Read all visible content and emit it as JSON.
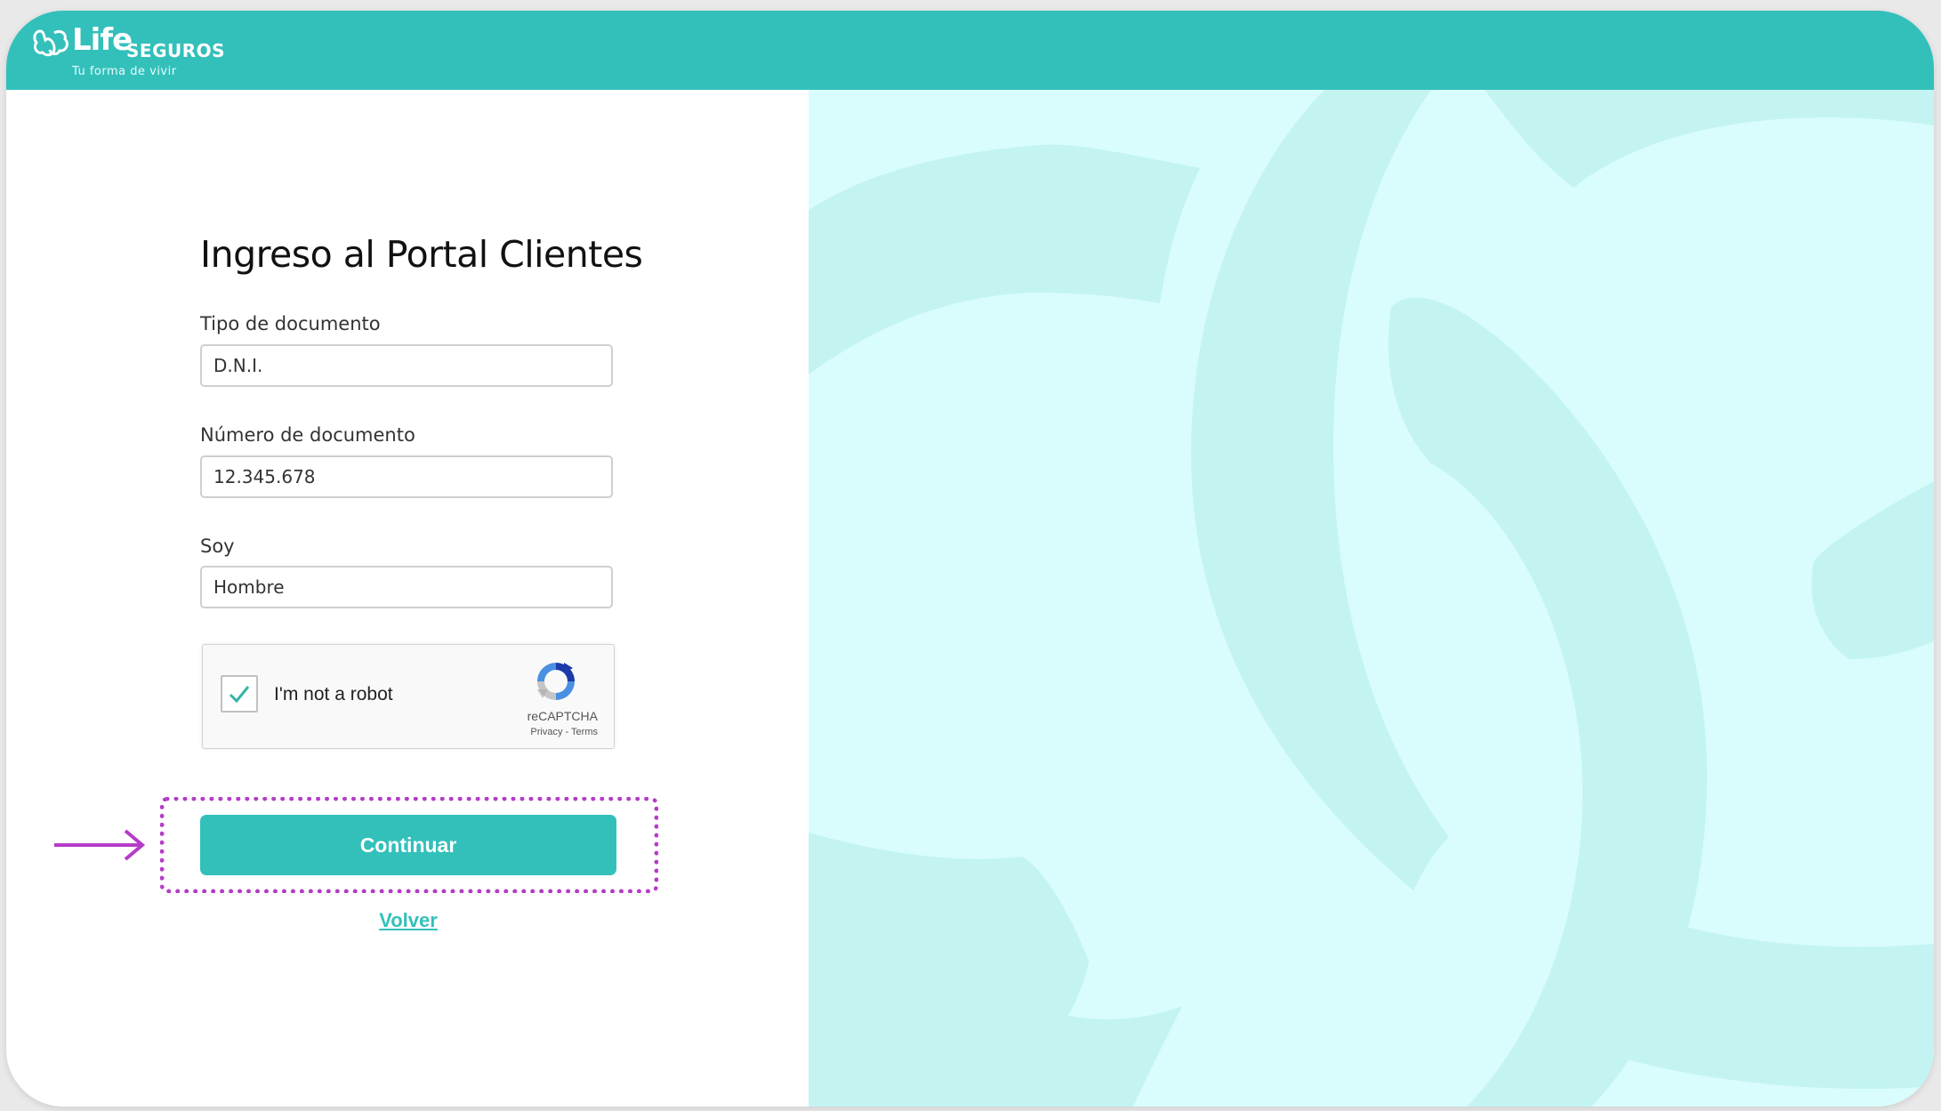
{
  "header": {
    "brand_name": "Life",
    "brand_suffix": "SEGUROS",
    "tagline": "Tu forma de vivir",
    "background_color": "#33c0bb",
    "logo_icon": "life-logo-icon"
  },
  "form": {
    "title": "Ingreso al Portal Clientes",
    "document_type": {
      "label": "Tipo de documento",
      "value": "D.N.I."
    },
    "document_number": {
      "label": "Número de documento",
      "value": "12.345.678"
    },
    "gender": {
      "label": "Soy",
      "value": "Hombre"
    },
    "captcha": {
      "label": "I'm not a robot",
      "checked": true,
      "brand": "reCAPTCHA",
      "links": "Privacy - Terms",
      "icon": "recaptcha-icon"
    },
    "continue_label": "Continuar",
    "back_label": "Volver"
  },
  "annotation": {
    "highlight_color": "#b53cc8",
    "arrow_icon": "arrow-right-icon"
  },
  "colors": {
    "accent": "#33c0bb",
    "right_panel": "#d9fdfc",
    "right_panel_shapes": "#c3f4f2"
  }
}
